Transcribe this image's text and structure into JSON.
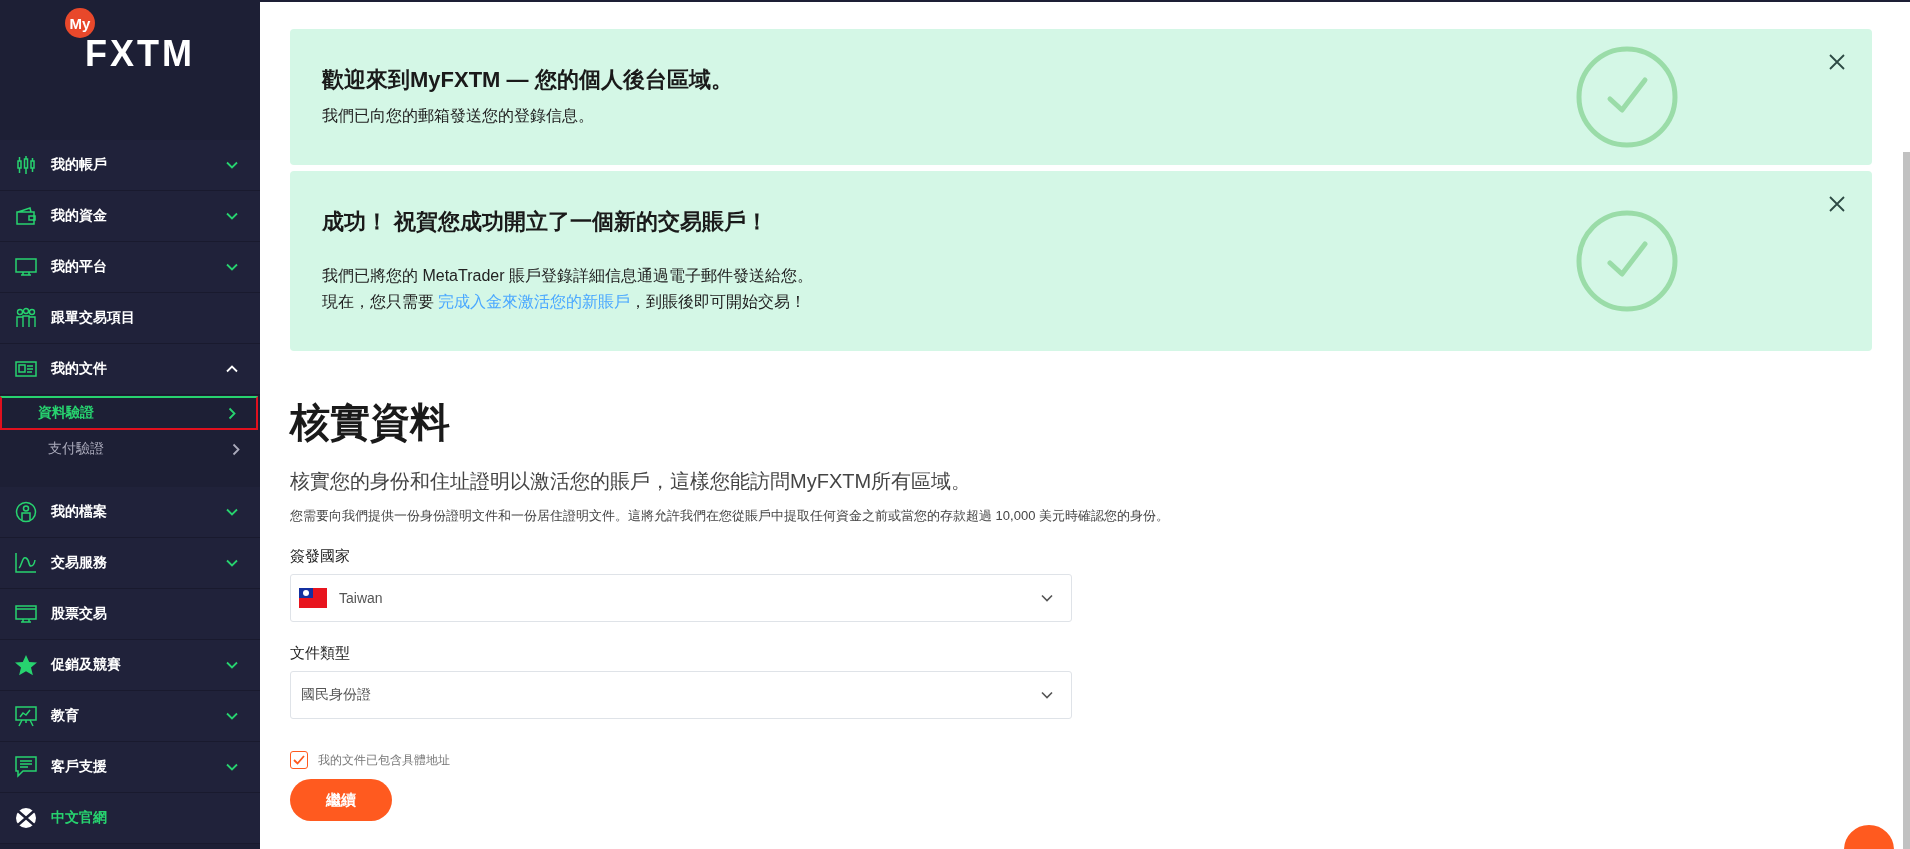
{
  "sidebar": {
    "logo": {
      "badge": "My",
      "wordmark": "FXTM"
    },
    "items": [
      {
        "label": "我的帳戶",
        "kind": "expandable",
        "expanded": false
      },
      {
        "label": "我的資金",
        "kind": "expandable",
        "expanded": false
      },
      {
        "label": "我的平台",
        "kind": "expandable",
        "expanded": false
      },
      {
        "label": "跟單交易項目",
        "kind": "plain"
      },
      {
        "label": "我的文件",
        "kind": "expandable",
        "expanded": true,
        "children": [
          {
            "label": "資料驗證",
            "selected": true
          },
          {
            "label": "支付驗證",
            "selected": false
          }
        ]
      },
      {
        "label": "我的檔案",
        "kind": "expandable",
        "expanded": false
      },
      {
        "label": "交易服務",
        "kind": "expandable",
        "expanded": false
      },
      {
        "label": "股票交易",
        "kind": "plain"
      },
      {
        "label": "促銷及競賽",
        "kind": "expandable",
        "expanded": false
      },
      {
        "label": "教育",
        "kind": "expandable",
        "expanded": false
      },
      {
        "label": "客戶支援",
        "kind": "expandable",
        "expanded": false
      },
      {
        "label": "中文官網",
        "kind": "external"
      }
    ]
  },
  "banners": [
    {
      "title": "歡迎來到MyFXTM — 您的個人後台區域。",
      "lines": [
        [
          {
            "text": "我們已向您的郵箱發送您的登錄信息。"
          }
        ]
      ]
    },
    {
      "title": "成功！ 祝賀您成功開立了一個新的交易賬戶！",
      "lines": [
        [
          {
            "text": "我們已將您的 MetaTrader 賬戶登錄詳細信息通過電子郵件發送給您。"
          }
        ],
        [
          {
            "text": "現在，您只需要 "
          },
          {
            "text": "完成入金來激活您的新賬戶",
            "kind": "link"
          },
          {
            "text": "，到賬後即可開始交易！"
          }
        ]
      ]
    }
  ],
  "verification": {
    "heading": "核實資料",
    "subtitle": "核實您的身份和住址證明以激活您的賬戶，這樣您能訪問MyFXTM所有區域。",
    "note": "您需要向我們提供一份身份證明文件和一份居住證明文件。這將允許我們在您從賬戶中提取任何資金之前或當您的存款超過 10,000 美元時確認您的身份。",
    "fields": [
      {
        "label": "簽發國家",
        "value": "Taiwan",
        "kind": "country"
      },
      {
        "label": "文件類型",
        "value": "國民身份證",
        "kind": "plain"
      }
    ],
    "checkbox": {
      "label": "我的文件已包含具體地址",
      "checked": true
    },
    "button": "繼續"
  }
}
